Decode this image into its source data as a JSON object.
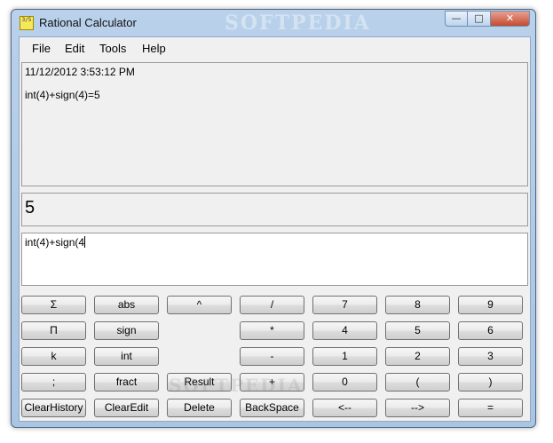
{
  "window": {
    "title": "Rational Calculator",
    "watermark": "SOFTPEDIA",
    "app_icon_glyph": "3/5"
  },
  "menu": [
    "File",
    "Edit",
    "Tools",
    "Help"
  ],
  "history": {
    "timestamp": "11/12/2012 3:53:12 PM",
    "entry": "int(4)+sign(4)=5"
  },
  "result": {
    "value": "5"
  },
  "input": {
    "value": "int(4)+sign(4"
  },
  "buttons": [
    [
      "Σ",
      "abs",
      "^",
      "/",
      "7",
      "8",
      "9"
    ],
    [
      "Π",
      "sign",
      "",
      "*",
      "4",
      "5",
      "6"
    ],
    [
      "k",
      "int",
      "",
      "-",
      "1",
      "2",
      "3"
    ],
    [
      ";",
      "fract",
      "Result",
      "+",
      "0",
      "(",
      ")"
    ],
    [
      "ClearHistory",
      "ClearEdit",
      "Delete",
      "BackSpace",
      "<--",
      "-->",
      "="
    ]
  ]
}
